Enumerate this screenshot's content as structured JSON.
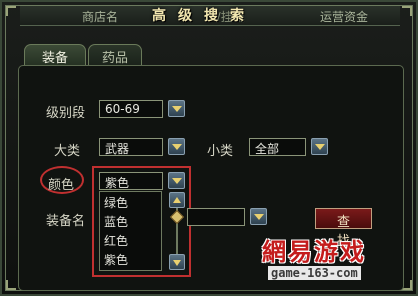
{
  "header": {
    "col_shop": "商店名",
    "col_mid": "L/挂嘿",
    "col_fund": "运营资金",
    "title": "高级搜索"
  },
  "tabs": [
    {
      "label": "装备",
      "active": true
    },
    {
      "label": "药品",
      "active": false
    }
  ],
  "form": {
    "level_label": "级别段",
    "level_value": "60-69",
    "category_label": "大类",
    "category_value": "武器",
    "subcategory_label": "小类",
    "subcategory_value": "全部",
    "color_label": "颜色",
    "color_value": "紫色",
    "name_label": "装备名",
    "name_value": ""
  },
  "color_options": [
    "绿色",
    "蓝色",
    "红色",
    "紫色"
  ],
  "search_label": "查 找",
  "watermark": {
    "brand_a": "網易",
    "brand_b": "游戏",
    "domain": "game-163-com"
  },
  "colors": {
    "accent_red": "#c03030",
    "button_blue": "#4a6070",
    "arrow_gold": "#e8d070"
  }
}
